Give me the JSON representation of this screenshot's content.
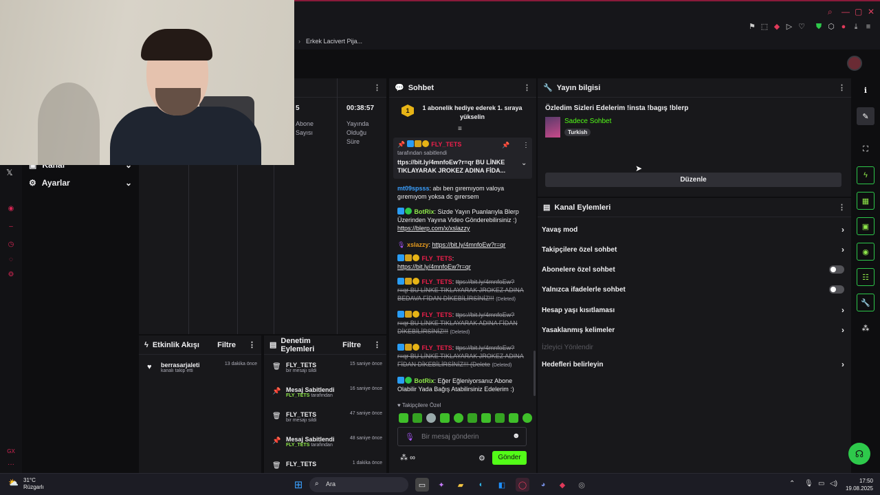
{
  "browser": {
    "tab_title": "Erkek Lacivert Pija..."
  },
  "nav": {
    "channel_label": "Kanal",
    "settings_label": "Ayarlar"
  },
  "stats": {
    "count_value": "5",
    "count_label_1": "Abone",
    "count_label_2": "Sayısı",
    "time_value": "00:38:57",
    "time_label_1": "Yayında",
    "time_label_2": "Olduğu",
    "time_label_3": "Süre"
  },
  "chat": {
    "title": "Sohbet",
    "gift_rank": "1",
    "gift_text_1": "1 abonelik hediye ederek 1. sıraya",
    "gift_text_2": "yükselin",
    "pinned": {
      "user": "FLY_TETS",
      "by": "tarafından sabitlendi",
      "text_1": "ttps://bit.ly/4mnfoEw?r=qr BU LİNKE",
      "text_2": "TIKLAYARAK JROKEZ ADINA FİDA..."
    },
    "messages": [
      {
        "user": "mt09spsss",
        "text_1": ": abı ben gıremıyom valoya",
        "text_2": "gıremıyom yoksa dc gırersem"
      },
      {
        "user": "BotRix",
        "text_1": ": Sizde Yayın Puanlarıyla Blerp",
        "text_2": "Üzerinden Yayına Video Gönderebilirsiniz :)",
        "link": "https://blerp.com/x/xslazzy"
      },
      {
        "user": "xslazzy",
        "text_1": ": ",
        "link": "https://bit.ly/4mnfoEw?r=qr"
      },
      {
        "user": "FLY_TETS",
        "text_1": ":",
        "link": "https://bit.ly/4mnfoEw?r=qr"
      },
      {
        "user": "FLY_TETS",
        "text_1": ":",
        "del_1": "ttps://bit.ly/4mnfoEw?",
        "del_2": "r=qr BU LİNKE TIKLAYARAK JROKEZ ADINA",
        "del_3": "BEDAVA FİDAN DİKEBİLİRSİNİZ!!!",
        "tag": "(Deleted)"
      },
      {
        "user": "FLY_TETS",
        "text_1": ":",
        "del_1": "ttps://bit.ly/4mnfoEw?",
        "del_2": "r=qr BU LİNKE TIKLAYARAK ADINA FİDAN",
        "del_3": "DİKEBİLİRSİNİZ!!!",
        "tag": "(Deleted)"
      },
      {
        "user": "FLY_TETS",
        "text_1": ":",
        "del_1": "ttps://bit.ly/4mnfoEw?",
        "del_2": "r=qr BU LİNKE TIKLAYARAK JROKEZ ADINA",
        "del_3": "FİDAN DİKEBİLİRSİNİZ!!! (Delete",
        "tag": "(Deleted)"
      },
      {
        "user": "BotRix",
        "text_1": ": Eğer Eğleniyorsanız Abone",
        "text_2": "Olabilir Yada Bağış Atabilirsiniz Edelerim :)"
      }
    ],
    "followers_only": "Takipçilere Özel",
    "input_placeholder": "Bir mesaj gönderin",
    "send_label": "Gönder",
    "points_label": "∞"
  },
  "info": {
    "title": "Yayın bilgisi",
    "stream_title": "Özledim Sizleri Edelerim !insta !bagış !blerp",
    "category": "Sadece Sohbet",
    "language": "Turkish",
    "edit_label": "Düzenle"
  },
  "actions": {
    "title": "Kanal Eylemleri",
    "items": [
      {
        "label": "Yavaş mod"
      },
      {
        "label": "Takipçilere özel sohbet"
      },
      {
        "label": "Abonelere özel sohbet"
      },
      {
        "label": "Yalnızca ifadelerle sohbet"
      },
      {
        "label": "Hesap yaşı kısıtlaması"
      },
      {
        "label": "Yasaklanmış kelimeler"
      },
      {
        "label": "İzleyici Yönlendir"
      },
      {
        "label": "Hedefleri belirleyin"
      }
    ]
  },
  "events": {
    "title": "Etkinlik Akışı",
    "filter_label": "Filtre",
    "items": [
      {
        "user": "berrasarjaleti",
        "sub": "kanalı takip etti",
        "time": "13 dakika önce"
      }
    ]
  },
  "audit": {
    "title": "Denetim Eylemleri",
    "filter_label": "Filtre",
    "items": [
      {
        "title": "FLY_TETS",
        "sub": "bir mesajı sildi",
        "time": "15 saniye önce"
      },
      {
        "title": "Mesaj Sabitlendi",
        "sub_user": "FLY_TETS",
        "sub": " tarafından",
        "time": "16 saniye önce"
      },
      {
        "title": "FLY_TETS",
        "sub": "bir mesajı sildi",
        "time": "47 saniye önce"
      },
      {
        "title": "Mesaj Sabitlendi",
        "sub_user": "FLY_TETS",
        "sub": " tarafından",
        "time": "48 saniye önce"
      },
      {
        "title": "FLY_TETS",
        "sub": "",
        "time": "1 dakika önce"
      }
    ]
  },
  "taskbar": {
    "weather_temp": "31°C",
    "weather_desc": "Rüzgarlı",
    "search_label": "Ara",
    "time": "17:50",
    "date": "19.08.2025"
  },
  "colors": {
    "accent_green": "#53fc18",
    "danger": "#ef1f4b",
    "panel": "#18181b"
  }
}
